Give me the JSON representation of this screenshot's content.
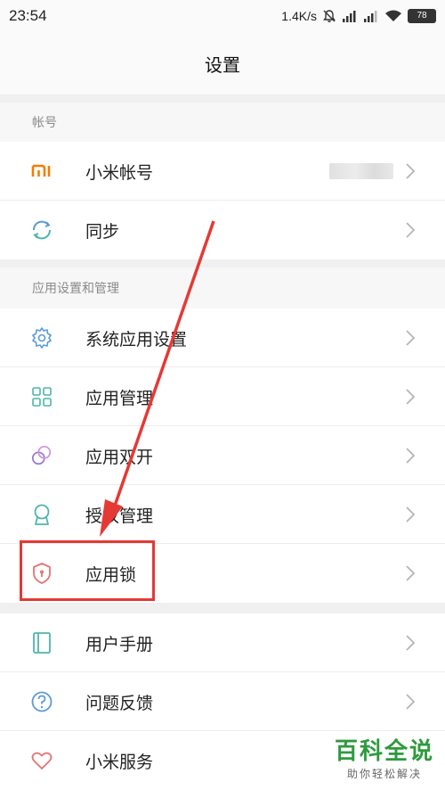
{
  "status_bar": {
    "time": "23:54",
    "network_speed": "1.4K/s",
    "battery": "78",
    "icons": [
      "mute-bell-icon",
      "signal-icon",
      "signal-icon",
      "wifi-icon",
      "battery-icon"
    ]
  },
  "header": {
    "title": "设置"
  },
  "sections": {
    "account": {
      "title": "帐号",
      "items": [
        {
          "label": "小米帐号",
          "icon": "mi-logo-icon"
        },
        {
          "label": "同步",
          "icon": "sync-icon"
        }
      ]
    },
    "apps": {
      "title": "应用设置和管理",
      "items": [
        {
          "label": "系统应用设置",
          "icon": "gear-icon"
        },
        {
          "label": "应用管理",
          "icon": "grid-icon"
        },
        {
          "label": "应用双开",
          "icon": "dual-circle-icon"
        },
        {
          "label": "授权管理",
          "icon": "badge-icon"
        },
        {
          "label": "应用锁",
          "icon": "shield-lock-icon"
        }
      ]
    },
    "other": {
      "items": [
        {
          "label": "用户手册",
          "icon": "book-icon"
        },
        {
          "label": "问题反馈",
          "icon": "question-icon"
        },
        {
          "label": "小米服务",
          "icon": "heart-icon"
        }
      ]
    }
  },
  "colors": {
    "accent_orange": "#f57c00",
    "accent_teal": "#4db6ac",
    "accent_blue": "#5c9bd6",
    "accent_purple": "#9575cd",
    "accent_red": "#e53935",
    "watermark_green": "#2e9a3e"
  },
  "watermark": {
    "main": "百科全说",
    "sub": "助你轻松解决"
  }
}
